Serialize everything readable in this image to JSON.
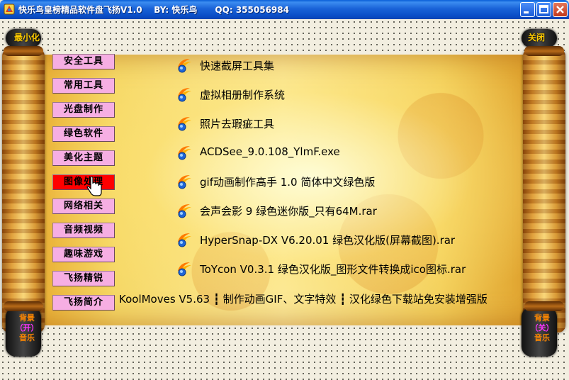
{
  "window": {
    "title": "快乐鸟皇榜精品软件盘飞扬V1.0    BY: 快乐鸟      QQ: 355056984"
  },
  "corner": {
    "minimize": "最小化",
    "close": "关闭"
  },
  "music_left": {
    "line1": "背景",
    "line2": "（开）",
    "line3": "音乐"
  },
  "music_right": {
    "line1": "背景",
    "line2": "（关）",
    "line3": "音乐"
  },
  "categories": [
    {
      "label": "安全工具"
    },
    {
      "label": "常用工具"
    },
    {
      "label": "光盘制作"
    },
    {
      "label": "绿色软件"
    },
    {
      "label": "美化主题"
    },
    {
      "label": "图像处理"
    },
    {
      "label": "网络相关"
    },
    {
      "label": "音频视频"
    },
    {
      "label": "趣味游戏"
    },
    {
      "label": "飞扬精锐"
    },
    {
      "label": "飞扬简介"
    }
  ],
  "active_category": "图像处理",
  "items": [
    {
      "label": "快速截屏工具集"
    },
    {
      "label": "虚拟相册制作系统"
    },
    {
      "label": "照片去瑕疵工具"
    },
    {
      "label": "ACDSee_9.0.108_YlmF.exe"
    },
    {
      "label": "gif动画制作高手 1.0 简体中文绿色版"
    },
    {
      "label": "会声会影 9 绿色迷你版_只有64M.rar"
    },
    {
      "label": "HyperSnap-DX V6.20.01 绿色汉化版(屏幕截图).rar"
    },
    {
      "label": "ToYcon V0.3.1 绿色汉化版_图形文件转换成ico图标.rar"
    }
  ],
  "bottom_item": "KoolMoves V5.63 ┇ 制作动画GIF、文字特效 ┇ 汉化绿色下载站免安装增强版",
  "colors": {
    "category_bg": "#f6aee3",
    "category_active": "#ff0000",
    "corner_label": "#ffcc00",
    "music_text": "#ff8800",
    "music_state": "#ff33ff"
  },
  "icons": {
    "item": "orange-ribbon-globe-icon",
    "app": "app-icon"
  }
}
